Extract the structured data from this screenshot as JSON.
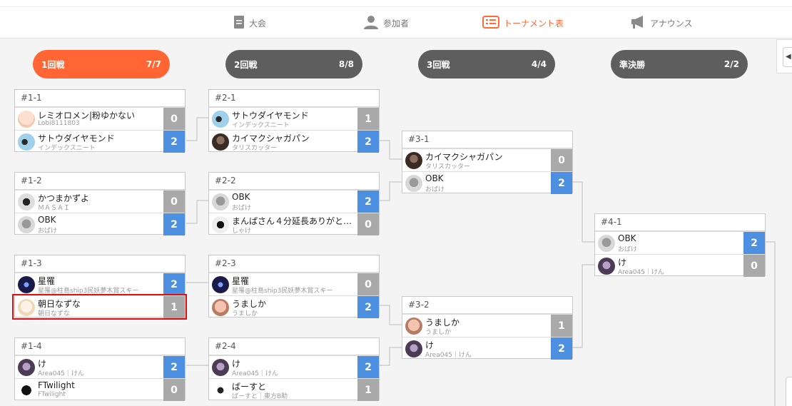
{
  "nav": [
    {
      "label": "大会",
      "icon": "document-icon"
    },
    {
      "label": "参加者",
      "icon": "user-icon"
    },
    {
      "label": "トーナメント表",
      "icon": "bracket-list-icon"
    },
    {
      "label": "アナウンス",
      "icon": "megaphone-icon"
    }
  ],
  "rounds": [
    {
      "name": "1回戦",
      "count": "7/7",
      "state": "active"
    },
    {
      "name": "2回戦",
      "count": "8/8",
      "state": "inactive"
    },
    {
      "name": "3回戦",
      "count": "4/4",
      "state": "inactive"
    },
    {
      "name": "準決勝",
      "count": "2/2",
      "state": "inactive"
    }
  ],
  "matches": {
    "m1_1": {
      "id": "#1-1",
      "players": [
        {
          "name": "レミオロメン|粉ゆかない",
          "sub": "Lobi8111803",
          "score": "0",
          "result": "lose"
        },
        {
          "name": "サトウダイヤモンド",
          "sub": "インデックスニート",
          "score": "2",
          "result": "win"
        }
      ]
    },
    "m1_2": {
      "id": "#1-2",
      "players": [
        {
          "name": "かつまかずよ",
          "sub": "ＭＡＳＡＩ",
          "score": "0",
          "result": "lose"
        },
        {
          "name": "OBK",
          "sub": "おばけ",
          "score": "2",
          "result": "win"
        }
      ]
    },
    "m1_3": {
      "id": "#1-3",
      "players": [
        {
          "name": "星罹",
          "sub": "星罹@柱島ship3民妖夢木賞スキー",
          "score": "2",
          "result": "win"
        },
        {
          "name": "朝日なずな",
          "sub": "朝日なずな",
          "score": "1",
          "result": "lose"
        }
      ]
    },
    "m1_4": {
      "id": "#1-4",
      "players": [
        {
          "name": "け",
          "sub": "Area045｜けん",
          "score": "2",
          "result": "win"
        },
        {
          "name": "FTwilight",
          "sub": "FTwilight",
          "score": "0",
          "result": "lose"
        }
      ]
    },
    "m2_1": {
      "id": "#2-1",
      "players": [
        {
          "name": "サトウダイヤモンド",
          "sub": "インデックスニート",
          "score": "1",
          "result": "lose"
        },
        {
          "name": "カイマクシャガパン",
          "sub": "タリスカッター",
          "score": "2",
          "result": "win"
        }
      ]
    },
    "m2_2": {
      "id": "#2-2",
      "players": [
        {
          "name": "OBK",
          "sub": "おばけ",
          "score": "2",
          "result": "win"
        },
        {
          "name": "まんぱさん４分延長ありがと…",
          "sub": "しゃけ",
          "score": "0",
          "result": "lose"
        }
      ]
    },
    "m2_3": {
      "id": "#2-3",
      "players": [
        {
          "name": "星罹",
          "sub": "星罹@柱島ship3民妖夢木賞スキー",
          "score": "0",
          "result": "lose"
        },
        {
          "name": "うましか",
          "sub": "うましか",
          "score": "2",
          "result": "win"
        }
      ]
    },
    "m2_4": {
      "id": "#2-4",
      "players": [
        {
          "name": "け",
          "sub": "Area045｜けん",
          "score": "2",
          "result": "win"
        },
        {
          "name": "ばーすと",
          "sub": "ばーすと｜東方B助",
          "score": "1",
          "result": "lose"
        }
      ]
    },
    "m3_1": {
      "id": "#3-1",
      "players": [
        {
          "name": "カイマクシャガパン",
          "sub": "タリスカッター",
          "score": "0",
          "result": "lose"
        },
        {
          "name": "OBK",
          "sub": "おばけ",
          "score": "2",
          "result": "win"
        }
      ]
    },
    "m3_2": {
      "id": "#3-2",
      "players": [
        {
          "name": "うましか",
          "sub": "うましか",
          "score": "1",
          "result": "lose"
        },
        {
          "name": "け",
          "sub": "Area045｜けん",
          "score": "2",
          "result": "win"
        }
      ]
    },
    "m4_1": {
      "id": "#4-1",
      "players": [
        {
          "name": "OBK",
          "sub": "おばけ",
          "score": "2",
          "result": "win"
        },
        {
          "name": "け",
          "sub": "Area045｜けん",
          "score": "0",
          "result": "lose"
        }
      ]
    }
  },
  "colors": {
    "accent": "#ff6633",
    "win": "#4d8fe0",
    "lose": "#a9a9a9",
    "inactive_pill": "#5e5e5e",
    "highlight": "#e01010"
  }
}
